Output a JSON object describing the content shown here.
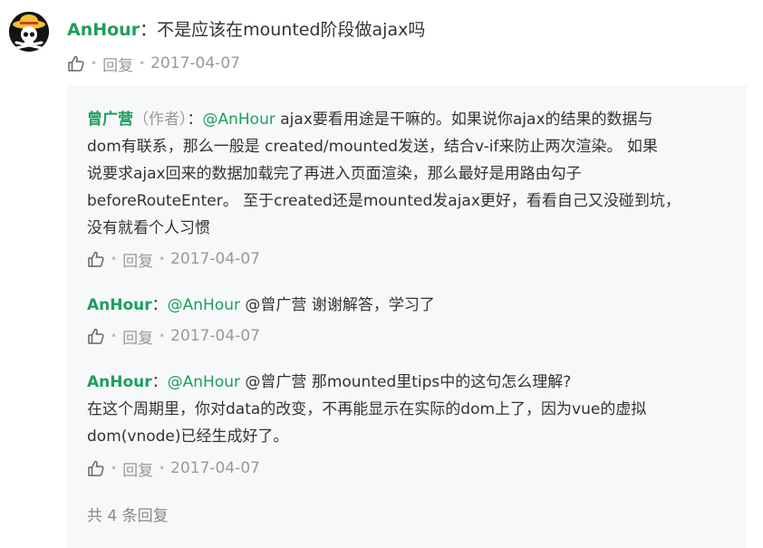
{
  "top_comment": {
    "author": "AnHour",
    "separator": "：",
    "text": "不是应该在mounted阶段做ajax吗",
    "reply_label": "回复",
    "date": "2017-04-07"
  },
  "replies": [
    {
      "author": "曾广营",
      "role": "（作者）",
      "separator": "：",
      "mention": "@AnHour",
      "lines": [
        " ajax要看用途是干嘛的。如果说你ajax的结果的数据与",
        "dom有联系，那么一般是 created/mounted发送，结合v-if来防止两次渲染。 如果",
        "说要求ajax回来的数据加载完了再进入页面渲染，那么最好是用路由勾子",
        "beforeRouteEnter。 至于created还是mounted发ajax更好，看看自己又没碰到坑，",
        "没有就看个人习惯"
      ],
      "reply_label": "回复",
      "date": "2017-04-07"
    },
    {
      "author": "AnHour",
      "separator": "：",
      "mention": "@AnHour",
      "lines": [
        " @曾广营 谢谢解答，学习了"
      ],
      "reply_label": "回复",
      "date": "2017-04-07"
    },
    {
      "author": "AnHour",
      "separator": "：",
      "mention": "@AnHour",
      "lines": [
        " @曾广营 那mounted里tips中的这句怎么理解?",
        "在这个周期里，你对data的改变，不再能显示在实际的dom上了，因为vue的虚拟",
        "dom(vnode)已经生成好了。"
      ],
      "reply_label": "回复",
      "date": "2017-04-07"
    }
  ],
  "reply_count_text": "共 4 条回复",
  "colors": {
    "author": "#1e9e5e",
    "muted": "#999999",
    "panel_bg": "#f7f8fa"
  },
  "icons": {
    "avatar": "straw-hat-skull-icon",
    "like": "thumbs-up-icon"
  }
}
